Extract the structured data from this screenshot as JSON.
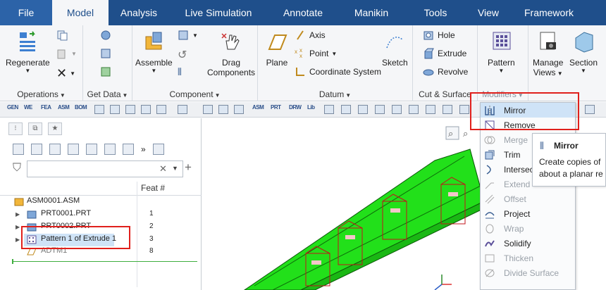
{
  "menubar": {
    "tabs": [
      "File",
      "Model",
      "Analysis",
      "Live Simulation",
      "Annotate",
      "Manikin",
      "Tools",
      "View",
      "Framework"
    ]
  },
  "ribbon": {
    "groups": {
      "operations": "Operations",
      "get_data": "Get Data",
      "component": "Component",
      "datum": "Datum",
      "cut_surface": "Cut & Surface",
      "modifiers": "Modifiers"
    },
    "buttons": {
      "regenerate": "Regenerate",
      "assemble": "Assemble",
      "drag_components_1": "Drag",
      "drag_components_2": "Components",
      "plane": "Plane",
      "axis": "Axis",
      "point": "Point",
      "coordinate_system": "Coordinate System",
      "sketch": "Sketch",
      "hole": "Hole",
      "extrude": "Extrude",
      "revolve": "Revolve",
      "pattern": "Pattern",
      "manage_views_1": "Manage",
      "manage_views_2": "Views",
      "section": "Section"
    }
  },
  "quick_toolbar": {
    "labels": [
      "GEN",
      "WE",
      "FEA",
      "ASM",
      "BOM",
      "ASM",
      "PRT",
      "DRW",
      "Lib"
    ]
  },
  "model_tree": {
    "column_header": "Feat #",
    "filter_value": "",
    "rows": [
      {
        "label": "ASM0001.ASM",
        "num": ""
      },
      {
        "label": "PRT0001.PRT",
        "num": "1"
      },
      {
        "label": "PRT0002.PRT",
        "num": "2"
      },
      {
        "label": "Pattern 1 of Extrude 1",
        "num": "3"
      },
      {
        "label": "ADTM1",
        "num": "8"
      }
    ]
  },
  "modifiers_menu": {
    "items": [
      {
        "label": "Mirror",
        "enabled": true
      },
      {
        "label": "Remove",
        "enabled": true
      },
      {
        "label": "Merge",
        "enabled": false
      },
      {
        "label": "Trim",
        "enabled": true
      },
      {
        "label": "Intersect",
        "enabled": true
      },
      {
        "label": "Extend",
        "enabled": false
      },
      {
        "label": "Offset",
        "enabled": false
      },
      {
        "label": "Project",
        "enabled": true
      },
      {
        "label": "Wrap",
        "enabled": false
      },
      {
        "label": "Solidify",
        "enabled": true
      },
      {
        "label": "Thicken",
        "enabled": false
      },
      {
        "label": "Divide Surface",
        "enabled": false
      }
    ]
  },
  "tooltip": {
    "title": "Mirror",
    "line1": "Create copies of",
    "line2": "about a planar re"
  },
  "colors": {
    "menubar": "#1f4f8b",
    "model_green": "#22e01a",
    "highlight": "#cfe3f7",
    "annotation_red": "#e0201c"
  }
}
